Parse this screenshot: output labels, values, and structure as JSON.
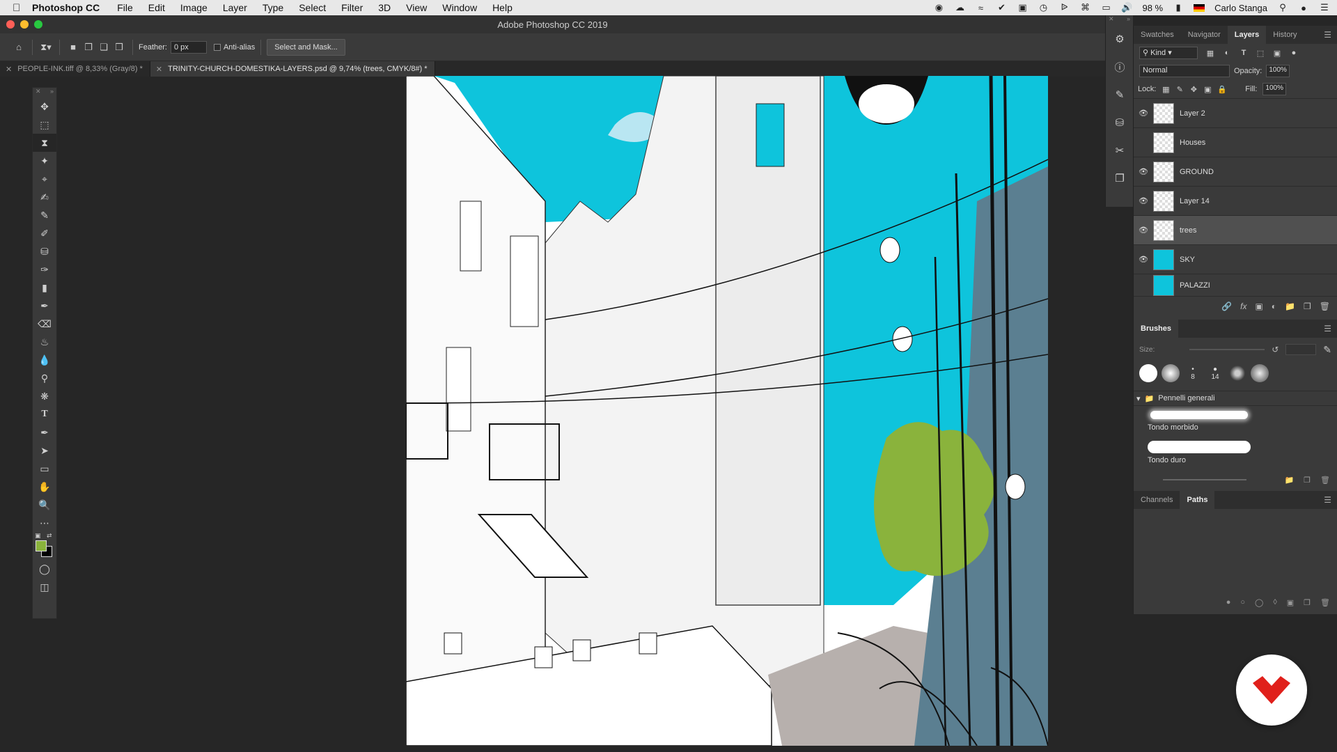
{
  "menubar": {
    "app_name": "Photoshop CC",
    "items": [
      "File",
      "Edit",
      "Image",
      "Layer",
      "Type",
      "Select",
      "Filter",
      "3D",
      "View",
      "Window",
      "Help"
    ],
    "battery": "98 %",
    "user": "Carlo Stanga"
  },
  "window": {
    "title": "Adobe Photoshop CC 2019"
  },
  "options": {
    "feather_label": "Feather:",
    "feather_value": "0 px",
    "antialias_label": "Anti-alias",
    "select_mask_label": "Select and Mask..."
  },
  "tabs": [
    {
      "label": "PEOPLE-INK.tiff @ 8,33% (Gray/8) *"
    },
    {
      "label": "TRINITY-CHURCH-DOMESTIKA-LAYERS.psd @ 9,74% (trees, CMYK/8#) *"
    }
  ],
  "panels": {
    "top_tabs": [
      "Swatches",
      "Navigator",
      "Layers",
      "History"
    ],
    "kind_label": "Kind",
    "blend_mode": "Normal",
    "opacity_label": "Opacity:",
    "opacity_value": "100%",
    "lock_label": "Lock:",
    "fill_label": "Fill:",
    "fill_value": "100%",
    "layers": [
      {
        "name": "Layer 2",
        "visible": true
      },
      {
        "name": "Houses",
        "visible": false
      },
      {
        "name": "GROUND",
        "visible": true
      },
      {
        "name": "Layer 14",
        "visible": true
      },
      {
        "name": "trees",
        "visible": true
      },
      {
        "name": "SKY",
        "visible": true
      },
      {
        "name": "PALAZZI",
        "visible": false
      }
    ],
    "brushes_title": "Brushes",
    "size_label": "Size:",
    "tip_numbers": [
      "8",
      "14"
    ],
    "brush_folder": "Pennelli generali",
    "brush_items": [
      "Tondo morbido",
      "Tondo duro"
    ],
    "bottom_tabs": [
      "Channels",
      "Paths"
    ]
  },
  "colors": {
    "sky": "#0ec4dc",
    "tree_green": "#8ab33c",
    "shadow_blue": "#5b7f91",
    "ground": "#b7b0ad",
    "accent_red": "#e0201b"
  }
}
